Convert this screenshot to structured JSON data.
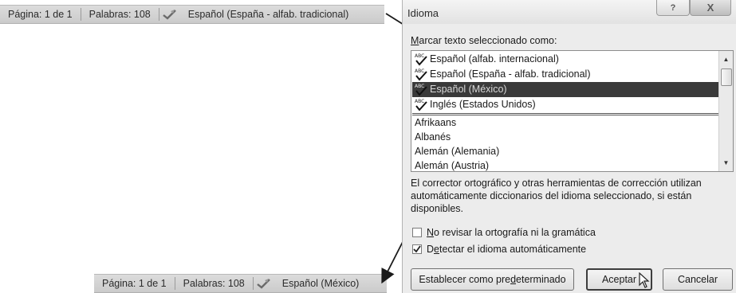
{
  "status_top": {
    "page": "Página: 1 de 1",
    "words": "Palabras: 108",
    "language": "Español (España - alfab. tradicional)"
  },
  "status_bottom": {
    "page": "Página: 1 de 1",
    "words": "Palabras: 108",
    "language": "Español (México)"
  },
  "dialog": {
    "title": "Idioma",
    "help_glyph": "?",
    "close_glyph": "X",
    "list_label_rest": "arcar texto seleccionado como:",
    "list_label_access": "M",
    "languages": [
      {
        "label": "Español (alfab. internacional)",
        "proofing": true
      },
      {
        "label": "Español (España - alfab. tradicional)",
        "proofing": true
      },
      {
        "label": "Español (México)",
        "proofing": true,
        "selected": true
      },
      {
        "label": "Inglés (Estados Unidos)",
        "proofing": true
      },
      {
        "label": "Afrikaans",
        "proofing": false
      },
      {
        "label": "Albanés",
        "proofing": false
      },
      {
        "label": "Alemán (Alemania)",
        "proofing": false
      },
      {
        "label": "Alemán (Austria)",
        "proofing": false
      }
    ],
    "description": "El corrector ortográfico y otras herramientas de corrección utilizan automáticamente diccionarios del idioma seleccionado, si están disponibles.",
    "no_proof": {
      "access": "N",
      "rest": "o revisar la ortografía ni la gramática",
      "checked": false
    },
    "detect": {
      "pre": "D",
      "access": "e",
      "rest": "tectar el idioma automáticamente",
      "checked": true
    },
    "set_default": {
      "pre": "Establecer como pre",
      "access": "d",
      "rest": "eterminado"
    },
    "ok": "Aceptar",
    "cancel": "Cancelar"
  },
  "icons": {
    "proofing": "abc-check-icon",
    "spelling_status": "spelling-check-icon",
    "scroll_up": "scroll-up-arrow-icon",
    "scroll_down": "scroll-down-arrow-icon",
    "cursor": "mouse-pointer-icon"
  },
  "colors": {
    "selection": "#3a3a3a",
    "dialog_bg": "#ececec",
    "statusbar_bg": "#d4d4d4"
  }
}
